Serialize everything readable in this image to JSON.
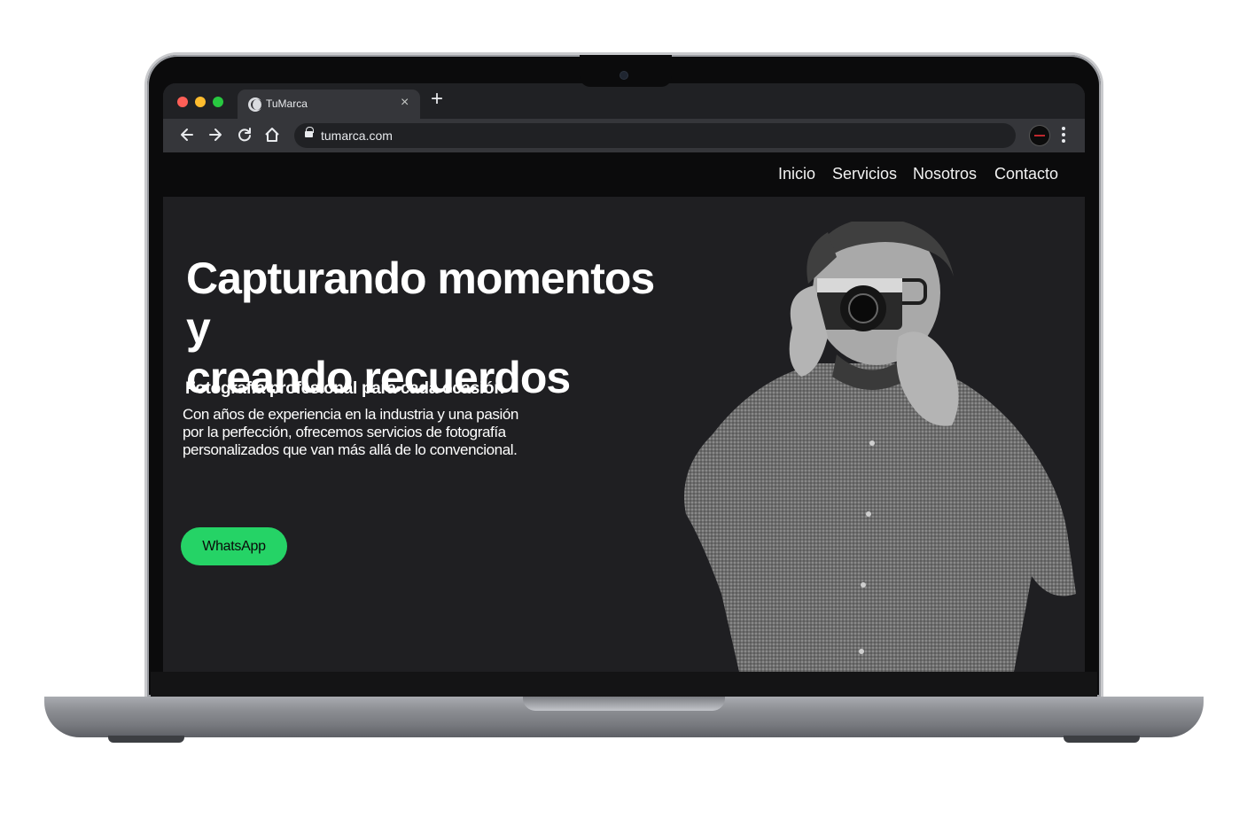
{
  "browser": {
    "tab_title": "TuMarca",
    "url": "tumarca.com",
    "tab_close_glyph": "×",
    "new_tab_glyph": "+",
    "icons": [
      "globe-icon",
      "close-icon",
      "plus-icon",
      "back-arrow-icon",
      "forward-arrow-icon",
      "reload-icon",
      "home-icon",
      "lock-icon",
      "profile-avatar",
      "more-vert-icon"
    ]
  },
  "site": {
    "nav": [
      "Inicio",
      "Servicios",
      "Nosotros",
      "Contacto"
    ],
    "hero": {
      "title_line1": "Capturando momentos y",
      "title_line2": "creando recuerdos",
      "subtitle": "Fotografía profesional para cada ocasión",
      "body": "Con años de experiencia en la industria y una pasión por la perfección, ofrecemos servicios de fotografía personalizados que van más allá de lo convencional.",
      "cta_label": "WhatsApp"
    },
    "colors": {
      "page_bg": "#1f1f22",
      "nav_bg": "#0b0b0c",
      "cta_bg": "#25d366",
      "text": "#ffffff"
    }
  }
}
